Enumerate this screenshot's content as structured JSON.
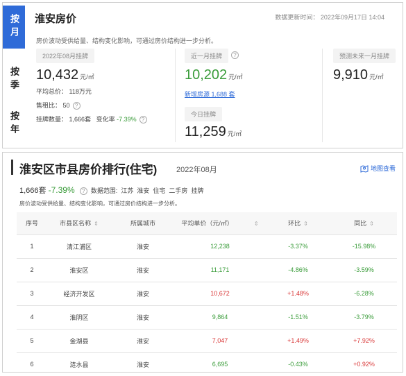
{
  "top": {
    "tabs": [
      "按月",
      "按季",
      "按年"
    ],
    "title": "淮安房价",
    "update_time": "数据更新时间： 2022年09月17日 14:04",
    "description": "房价波动受供给量、结构变化影响，可通过房价结构进一步分析。",
    "monthly": {
      "label": "2022年08月挂牌",
      "price": "10,432",
      "unit": "元/㎡",
      "avg_total_label": "平均总价：",
      "avg_total": "118万元",
      "rent_ratio_label": "售租比：",
      "rent_ratio": "50",
      "listings_label": "挂牌数量：",
      "listings": "1,666套",
      "change_label": "变化率",
      "change": "-7.39%"
    },
    "recent": {
      "label": "近一月挂牌",
      "price": "10,202",
      "unit": "元/㎡",
      "new_listings": "新增房源 1,688 套",
      "today_label": "今日挂牌",
      "today_price": "11,259",
      "today_unit": "元/㎡"
    },
    "forecast": {
      "label": "预测未来一月挂牌",
      "price": "9,910",
      "unit": "元/㎡"
    }
  },
  "bottom": {
    "title": "淮安区市县房价排行(住宅)",
    "date": "2022年08月",
    "map_link": "地图查看",
    "summary_count": "1,666套",
    "summary_change": "-7.39%",
    "scope_label": "数据范围:",
    "scope": "江苏  淮安  住宅  二手房  挂牌",
    "description": "房价波动受供给量、结构变化影响，可通过房价结构进一步分析。",
    "columns": [
      "序号",
      "市县区名称",
      "所属城市",
      "平均单价（元/㎡）",
      "环比",
      "同比"
    ],
    "rows": [
      {
        "idx": "1",
        "name": "清江浦区",
        "city": "淮安",
        "price": "12,238",
        "mom": "-3.37%",
        "yoy": "-15.98%"
      },
      {
        "idx": "2",
        "name": "淮安区",
        "city": "淮安",
        "price": "11,171",
        "mom": "-4.86%",
        "yoy": "-3.59%"
      },
      {
        "idx": "3",
        "name": "经济开发区",
        "city": "淮安",
        "price": "10,672",
        "mom": "+1.48%",
        "yoy": "-6.28%"
      },
      {
        "idx": "4",
        "name": "淮阴区",
        "city": "淮安",
        "price": "9,864",
        "mom": "-1.51%",
        "yoy": "-3.79%"
      },
      {
        "idx": "5",
        "name": "金湖县",
        "city": "淮安",
        "price": "7,047",
        "mom": "+1.49%",
        "yoy": "+7.92%"
      },
      {
        "idx": "6",
        "name": "涟水县",
        "city": "淮安",
        "price": "6,695",
        "mom": "-0.43%",
        "yoy": "+0.92%"
      }
    ],
    "colors": {
      "up": "#d93838",
      "down": "#3a9c3a",
      "accent": "#2f6bd8"
    }
  }
}
